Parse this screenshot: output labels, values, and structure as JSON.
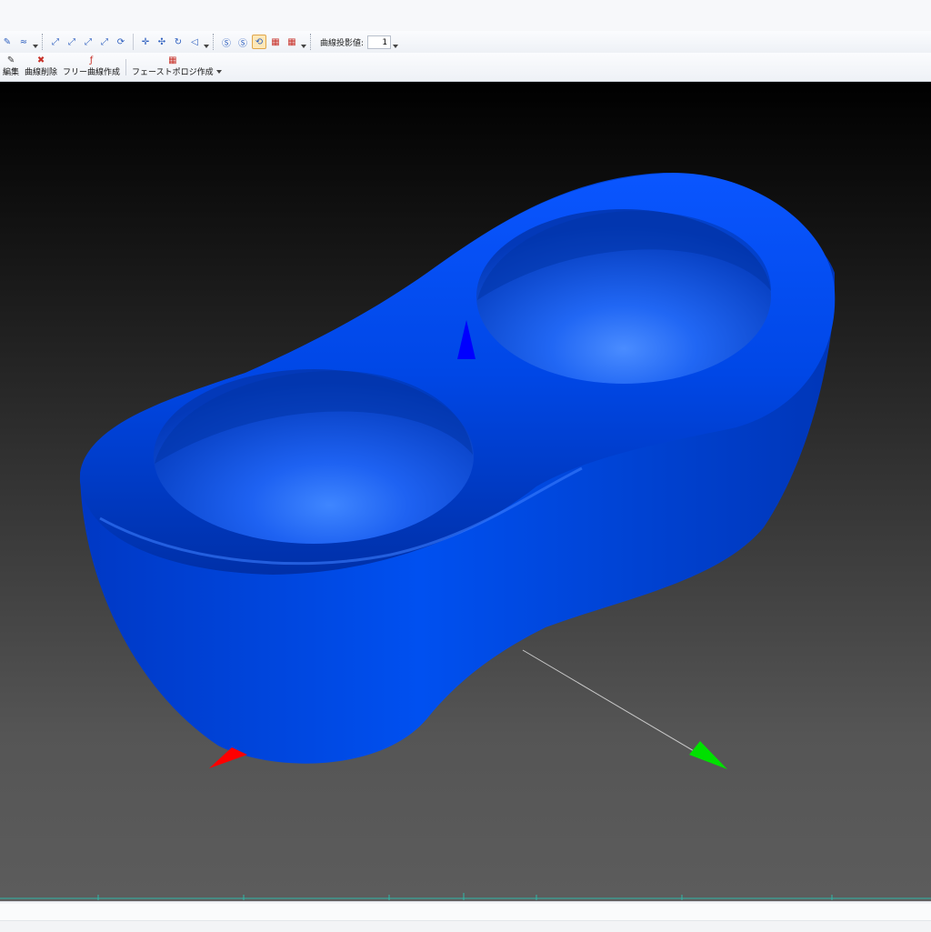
{
  "toolbar_row1": {
    "buttons": [
      {
        "icon": "brush-icon",
        "glyph": "✎"
      },
      {
        "icon": "curve-auto-icon",
        "glyph": "≈"
      },
      {
        "icon": "curve-edit-1-icon",
        "glyph": "⤢"
      },
      {
        "icon": "curve-edit-2-icon",
        "glyph": "⤢"
      },
      {
        "icon": "curve-edit-3-icon",
        "glyph": "⤢"
      },
      {
        "icon": "curve-edit-4-icon",
        "glyph": "⤢"
      },
      {
        "icon": "rotate-icon",
        "glyph": "⟳"
      },
      {
        "icon": "move-plus-icon",
        "glyph": "✛"
      },
      {
        "icon": "move-cross-icon",
        "glyph": "✣"
      },
      {
        "icon": "loop-icon",
        "glyph": "↻"
      },
      {
        "icon": "lasso-icon",
        "glyph": "◁"
      },
      {
        "icon": "nurbs-s-icon",
        "glyph": "Ⓢ"
      },
      {
        "icon": "s-circle-icon",
        "glyph": "Ⓢ"
      },
      {
        "icon": "refresh-active-icon",
        "glyph": "⟲"
      },
      {
        "icon": "grid-red-icon",
        "glyph": "▦"
      },
      {
        "icon": "grid-check-icon",
        "glyph": "▦"
      }
    ],
    "projection_label": "曲線投影値:",
    "projection_value": "1"
  },
  "toolbar_row2": {
    "commands": [
      {
        "name": "edit",
        "label": "編集",
        "icon": "edit-icon",
        "glyph": "✎"
      },
      {
        "name": "delete-curve",
        "label": "曲線削除",
        "icon": "delete-curve-icon",
        "glyph": "✖"
      },
      {
        "name": "free-curve",
        "label": "フリー曲線作成",
        "icon": "free-curve-icon",
        "glyph": "ƒ"
      },
      {
        "name": "face-topology",
        "label": "フェーストポロジ作成",
        "icon": "face-topology-icon",
        "glyph": "▦"
      }
    ]
  },
  "colors": {
    "model": "#0044ee",
    "axis_x": "#ff0000",
    "axis_y": "#00e000",
    "axis_z": "#0000ff",
    "active_button": "#fde8b8"
  },
  "viewport": {
    "background": "gradient-black-to-gray"
  }
}
